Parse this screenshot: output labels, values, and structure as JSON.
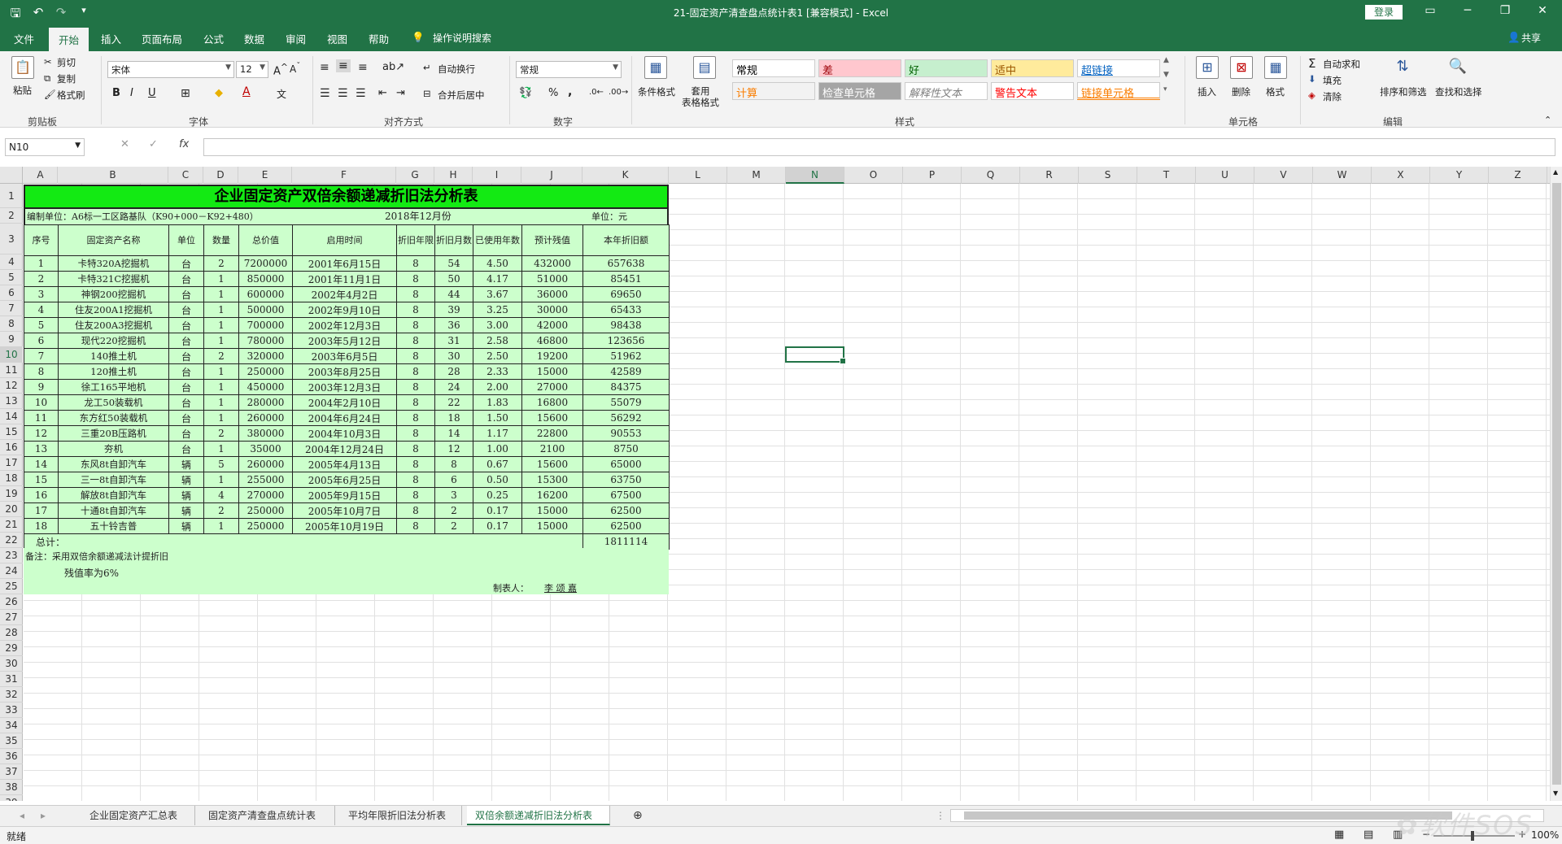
{
  "window": {
    "title": "21-固定资产清查盘点统计表1  [兼容模式]  -  Excel",
    "login_label": "登录",
    "qat": {
      "save_icon": "save-icon",
      "undo_icon": "undo-icon",
      "redo_icon": "redo-icon",
      "customize": "customize-qat-icon"
    }
  },
  "tabs": [
    "文件",
    "开始",
    "插入",
    "页面布局",
    "公式",
    "数据",
    "审阅",
    "视图",
    "帮助"
  ],
  "active_tab": "开始",
  "tell_me": "操作说明搜索",
  "share": "共享",
  "ribbon": {
    "clipboard": {
      "paste": "粘贴",
      "cut": "剪切",
      "copy": "复制",
      "format_painter": "格式刷",
      "label": "剪贴板"
    },
    "font": {
      "name": "宋体",
      "size": "12",
      "label": "字体",
      "bold": "B",
      "italic": "I",
      "underline": "U"
    },
    "alignment": {
      "wrap": "自动换行",
      "merge": "合并后居中",
      "label": "对齐方式"
    },
    "number": {
      "format": "常规",
      "label": "数字",
      "percent": "%",
      "comma": ","
    },
    "styles": {
      "conditional": "条件格式",
      "table": "套用\n表格格式",
      "label": "样式",
      "cells": [
        {
          "text": "常规",
          "bg": "#ffffff",
          "color": "#000000"
        },
        {
          "text": "差",
          "bg": "#ffc7ce",
          "color": "#9c0006"
        },
        {
          "text": "好",
          "bg": "#c6efce",
          "color": "#006100"
        },
        {
          "text": "适中",
          "bg": "#ffeb9c",
          "color": "#9c5700"
        },
        {
          "text": "超链接",
          "bg": "#ffffff",
          "color": "#0563c1"
        },
        {
          "text": "计算",
          "bg": "#f2f2f2",
          "color": "#fa7d00"
        },
        {
          "text": "检查单元格",
          "bg": "#a5a5a5",
          "color": "#ffffff"
        },
        {
          "text": "解释性文本",
          "bg": "#ffffff",
          "color": "#7f7f7f"
        },
        {
          "text": "警告文本",
          "bg": "#ffffff",
          "color": "#ff0000"
        },
        {
          "text": "链接单元格",
          "bg": "#ffffff",
          "color": "#fa7d00"
        }
      ]
    },
    "cells_grp": {
      "insert": "插入",
      "delete": "删除",
      "format": "格式",
      "label": "单元格"
    },
    "editing": {
      "autosum": "自动求和",
      "fill": "填充",
      "clear": "清除",
      "sort": "排序和筛选",
      "find": "查找和选择",
      "label": "编辑"
    }
  },
  "formula_bar": {
    "name_box": "N10",
    "cancel": "✕",
    "enter": "✓",
    "fx": "fx",
    "value": ""
  },
  "columns": [
    "A",
    "B",
    "C",
    "D",
    "E",
    "F",
    "G",
    "H",
    "I",
    "J",
    "K",
    "L",
    "M",
    "N",
    "O",
    "P",
    "Q",
    "R",
    "S",
    "T",
    "U",
    "V",
    "W",
    "X",
    "Y",
    "Z"
  ],
  "selected_column": "N",
  "selected_row": 10,
  "rows": [
    "1",
    "2",
    "3",
    "4",
    "5",
    "6",
    "7",
    "8",
    "9",
    "10",
    "11",
    "12",
    "13",
    "14",
    "15",
    "16",
    "17",
    "18",
    "19",
    "20",
    "21",
    "22",
    "23",
    "24",
    "25",
    "26",
    "27",
    "28",
    "29",
    "30",
    "31",
    "32",
    "33",
    "34",
    "35",
    "36",
    "37",
    "38",
    "39"
  ],
  "sheet": {
    "title": "企业固定资产双倍余额递减折旧法分析表",
    "unit_org": "编制单位：A6标一工区路基队（K90+000－K92+480）",
    "period": "2018年12月份",
    "unit": "单位：元",
    "headers": [
      "序号",
      "固定资产名称",
      "单位",
      "数量",
      "总价值",
      "启用时间",
      "折旧年限",
      "折旧月数",
      "已使用年数",
      "预计残值",
      "本年折旧额"
    ],
    "rows": [
      [
        "1",
        "卡特320A挖掘机",
        "台",
        "2",
        "7200000",
        "2001年6月15日",
        "8",
        "54",
        "4.50",
        "432000",
        "657638"
      ],
      [
        "2",
        "卡特321C挖掘机",
        "台",
        "1",
        "850000",
        "2001年11月1日",
        "8",
        "50",
        "4.17",
        "51000",
        "85451"
      ],
      [
        "3",
        "神钢200挖掘机",
        "台",
        "1",
        "600000",
        "2002年4月2日",
        "8",
        "44",
        "3.67",
        "36000",
        "69650"
      ],
      [
        "4",
        "住友200A1挖掘机",
        "台",
        "1",
        "500000",
        "2002年9月10日",
        "8",
        "39",
        "3.25",
        "30000",
        "65433"
      ],
      [
        "5",
        "住友200A3挖掘机",
        "台",
        "1",
        "700000",
        "2002年12月3日",
        "8",
        "36",
        "3.00",
        "42000",
        "98438"
      ],
      [
        "6",
        "现代220挖掘机",
        "台",
        "1",
        "780000",
        "2003年5月12日",
        "8",
        "31",
        "2.58",
        "46800",
        "123656"
      ],
      [
        "7",
        "140推土机",
        "台",
        "2",
        "320000",
        "2003年6月5日",
        "8",
        "30",
        "2.50",
        "19200",
        "51962"
      ],
      [
        "8",
        "120推土机",
        "台",
        "1",
        "250000",
        "2003年8月25日",
        "8",
        "28",
        "2.33",
        "15000",
        "42589"
      ],
      [
        "9",
        "徐工165平地机",
        "台",
        "1",
        "450000",
        "2003年12月3日",
        "8",
        "24",
        "2.00",
        "27000",
        "84375"
      ],
      [
        "10",
        "龙工50装载机",
        "台",
        "1",
        "280000",
        "2004年2月10日",
        "8",
        "22",
        "1.83",
        "16800",
        "55079"
      ],
      [
        "11",
        "东方红50装载机",
        "台",
        "1",
        "260000",
        "2004年6月24日",
        "8",
        "18",
        "1.50",
        "15600",
        "56292"
      ],
      [
        "12",
        "三重20B压路机",
        "台",
        "2",
        "380000",
        "2004年10月3日",
        "8",
        "14",
        "1.17",
        "22800",
        "90553"
      ],
      [
        "13",
        "夯机",
        "台",
        "1",
        "35000",
        "2004年12月24日",
        "8",
        "12",
        "1.00",
        "2100",
        "8750"
      ],
      [
        "14",
        "东风8t自卸汽车",
        "辆",
        "5",
        "260000",
        "2005年4月13日",
        "8",
        "8",
        "0.67",
        "15600",
        "65000"
      ],
      [
        "15",
        "三一8t自卸汽车",
        "辆",
        "1",
        "255000",
        "2005年6月25日",
        "8",
        "6",
        "0.50",
        "15300",
        "63750"
      ],
      [
        "16",
        "解放8t自卸汽车",
        "辆",
        "4",
        "270000",
        "2005年9月15日",
        "8",
        "3",
        "0.25",
        "16200",
        "67500"
      ],
      [
        "17",
        "十通8t自卸汽车",
        "辆",
        "2",
        "250000",
        "2005年10月7日",
        "8",
        "2",
        "0.17",
        "15000",
        "62500"
      ],
      [
        "18",
        "五十铃吉普",
        "辆",
        "1",
        "250000",
        "2005年10月19日",
        "8",
        "2",
        "0.17",
        "15000",
        "62500"
      ]
    ],
    "total_label": "总计：",
    "total_value": "1811114",
    "note1": "备注：采用双倍余额递减法计提折旧",
    "note2": "残值率为6%",
    "maker_label": "制表人：",
    "maker_name": "李  颂  嘉"
  },
  "sheet_tabs": [
    "企业固定资产汇总表",
    "固定资产清查盘点统计表",
    "平均年限折旧法分析表",
    "双倍余额递减折旧法分析表"
  ],
  "active_sheet": "双倍余额递减折旧法分析表",
  "status": {
    "ready": "就绪",
    "zoom": "100%"
  },
  "colors": {
    "excel_green": "#217346",
    "title_fill": "#13ea13",
    "table_fill": "#ccffcc"
  }
}
